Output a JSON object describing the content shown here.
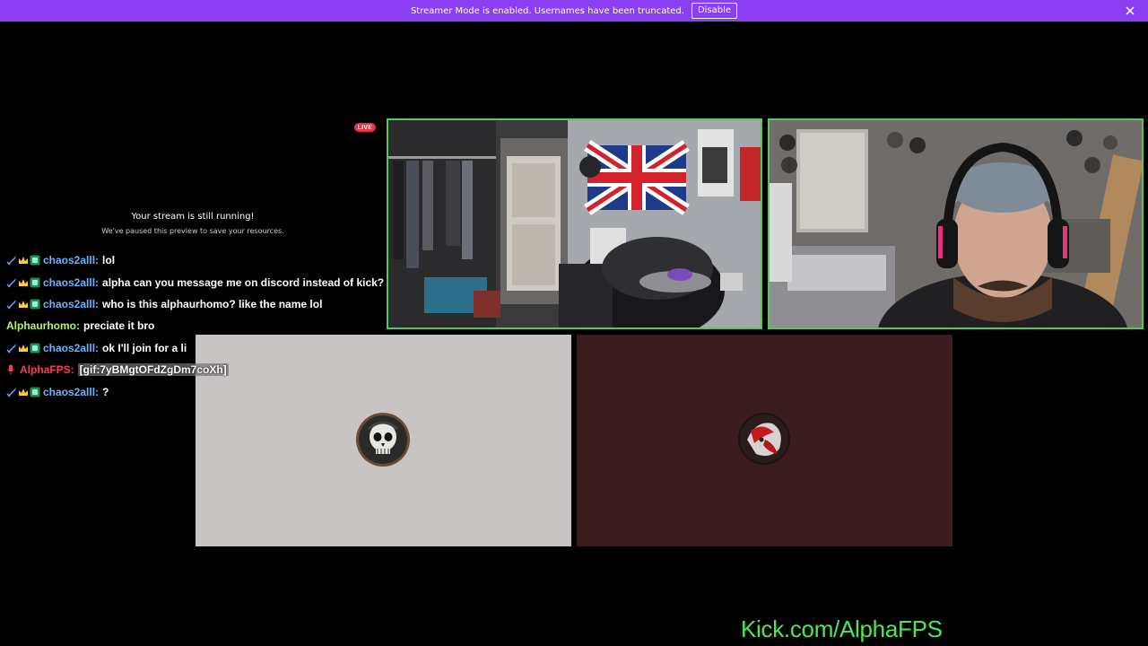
{
  "banner": {
    "message": "Streamer Mode is enabled. Usernames have been truncated.",
    "disable_label": "Disable",
    "color": "#8a3ff2"
  },
  "live_badge": "LIVE",
  "paused": {
    "title": "Your stream is still running!",
    "subtitle": "We've paused this preview to save your resources."
  },
  "chat": [
    {
      "badges": [
        "sword-icon",
        "crown-icon",
        "sub-badge-icon"
      ],
      "user": "chaos2alll:",
      "user_color": "#6cb4ff",
      "text": "lol"
    },
    {
      "badges": [
        "sword-icon",
        "crown-icon",
        "sub-badge-icon"
      ],
      "user": "chaos2alll:",
      "user_color": "#6cb4ff",
      "text": "alpha can you message me on discord instead of kick?"
    },
    {
      "badges": [
        "sword-icon",
        "crown-icon",
        "sub-badge-icon"
      ],
      "user": "chaos2alll:",
      "user_color": "#6cb4ff",
      "text": "who is this alphaurhomo? like the name lol"
    },
    {
      "badges": [],
      "user": "Alphaurhomo:",
      "user_color": "#b6f26a",
      "text": "preciate it bro"
    },
    {
      "badges": [
        "sword-icon",
        "crown-icon",
        "sub-badge-icon"
      ],
      "user": "chaos2alll:",
      "user_color": "#6cb4ff",
      "text": "ok I'll join for a li"
    },
    {
      "badges": [
        "mic-icon"
      ],
      "user": "AlphaFPS:",
      "user_color": "#ff3a5c",
      "text": "[gif:7yBMgtOFdZgDm7coXh]",
      "is_gif": true
    },
    {
      "badges": [
        "sword-icon",
        "crown-icon",
        "sub-badge-icon"
      ],
      "user": "chaos2alll:",
      "user_color": "#6cb4ff",
      "text": "?"
    }
  ],
  "tiles": {
    "cam1": "webcam-room-flag",
    "cam2": "webcam-headset-streamer",
    "avatar1": "skull-avatar",
    "avatar2": "red-anime-avatar"
  },
  "watermark": "Kick.com/AlphaFPS",
  "colors": {
    "accent": "#8a3ff2",
    "speaking_border": "#51c95f",
    "live": "#e0334a",
    "watermark": "#4de84d"
  }
}
